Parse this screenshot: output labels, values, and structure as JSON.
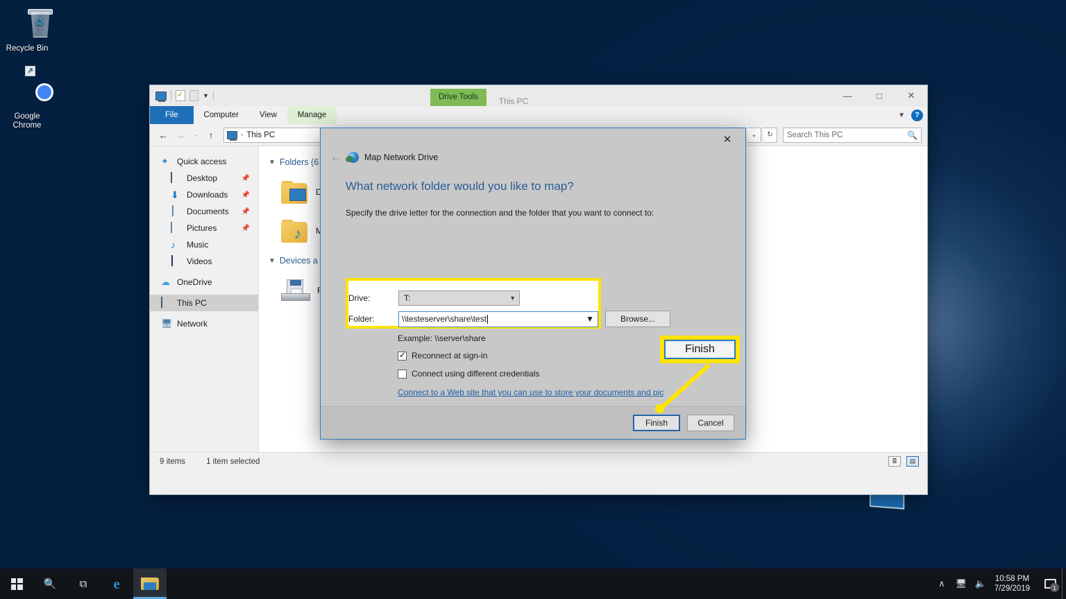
{
  "desktop": {
    "icons": [
      {
        "label": "Recycle Bin",
        "icon": "recycle-bin-icon"
      },
      {
        "label": "Google Chrome",
        "icon": "google-chrome-icon"
      }
    ]
  },
  "explorer": {
    "window_title": "This PC",
    "contextual_tab": "Drive Tools",
    "quick_access_toolbar": [
      "properties-icon",
      "new-folder-icon",
      "customize-icon"
    ],
    "ribbon_tabs": [
      {
        "label": "File",
        "state": "file"
      },
      {
        "label": "Computer",
        "state": "normal"
      },
      {
        "label": "View",
        "state": "normal"
      },
      {
        "label": "Manage",
        "state": "contextual"
      }
    ],
    "window_buttons": {
      "minimize": "—",
      "maximize": "□",
      "close": "✕"
    },
    "help_label": "?",
    "address": {
      "back": "←",
      "forward": "→",
      "recent": "⌄",
      "up": "↑",
      "crumb_separator": "›",
      "crumb_text": "This PC",
      "dropdown": "⌄",
      "refresh": "↻"
    },
    "search": {
      "placeholder": "Search This PC",
      "icon": "search-icon"
    },
    "navigation_pane": [
      {
        "label": "Quick access",
        "icon": "star-icon",
        "child": false,
        "pinned": false,
        "selected": false
      },
      {
        "label": "Desktop",
        "icon": "desktop-icon",
        "child": true,
        "pinned": true,
        "selected": false
      },
      {
        "label": "Downloads",
        "icon": "downloads-icon",
        "child": true,
        "pinned": true,
        "selected": false
      },
      {
        "label": "Documents",
        "icon": "documents-icon",
        "child": true,
        "pinned": true,
        "selected": false
      },
      {
        "label": "Pictures",
        "icon": "pictures-icon",
        "child": true,
        "pinned": true,
        "selected": false
      },
      {
        "label": "Music",
        "icon": "music-icon",
        "child": true,
        "pinned": false,
        "selected": false
      },
      {
        "label": "Videos",
        "icon": "videos-icon",
        "child": true,
        "pinned": false,
        "selected": false
      },
      {
        "label": "OneDrive",
        "icon": "onedrive-icon",
        "child": false,
        "pinned": false,
        "selected": false
      },
      {
        "label": "This PC",
        "icon": "this-pc-icon",
        "child": false,
        "pinned": false,
        "selected": true
      },
      {
        "label": "Network",
        "icon": "network-icon",
        "child": false,
        "pinned": false,
        "selected": false
      }
    ],
    "content": {
      "group_folders": "Folders (6",
      "group_devices": "Devices a",
      "items": [
        {
          "label": "De",
          "icon": "desktop-folder-icon"
        },
        {
          "label": "Mu",
          "icon": "music-folder-icon"
        }
      ],
      "devices": [
        {
          "label": "Flo",
          "icon": "floppy-drive-icon"
        }
      ]
    },
    "status_bar": {
      "count": "9 items",
      "selection": "1 item selected"
    },
    "view_buttons": {
      "details": "details-view-icon",
      "thumbnails": "large-icons-view-icon"
    }
  },
  "dialog": {
    "title": "Map Network Drive",
    "title_icon": "network-drive-icon",
    "back_arrow": "←",
    "close": "✕",
    "heading": "What network folder would you like to map?",
    "subheading": "Specify the drive letter for the connection and the folder that you want to connect to:",
    "drive_label": "Drive:",
    "drive_value": "T:",
    "folder_label": "Folder:",
    "folder_value": "\\\\testeserver\\share\\test",
    "browse_label": "Browse...",
    "example": "Example: \\\\server\\share",
    "checkbox_reconnect": {
      "label": "Reconnect at sign-in",
      "checked": true
    },
    "checkbox_credentials": {
      "label": "Connect using different credentials",
      "checked": false
    },
    "web_link": "Connect to a Web site that you can use to store your documents and pictures.",
    "finish_label": "Finish",
    "cancel_label": "Cancel"
  },
  "callout": {
    "label": "Finish",
    "border_color": "#ffe400",
    "inner_border_color": "#2a79c4"
  },
  "taskbar": {
    "start": "start-button",
    "search": "search-icon",
    "task_view": "task-view-icon",
    "apps": [
      {
        "name": "microsoft-edge-icon",
        "label": "e",
        "active": false
      },
      {
        "name": "file-explorer-icon",
        "label": "",
        "active": true
      }
    ],
    "tray": {
      "chevron": "∧",
      "network_icon": "network-tray-icon",
      "volume_icon": "volume-muted-icon",
      "time": "10:58 PM",
      "date": "7/29/2019",
      "action_center": "action-center-icon",
      "notification_count": "1"
    }
  }
}
